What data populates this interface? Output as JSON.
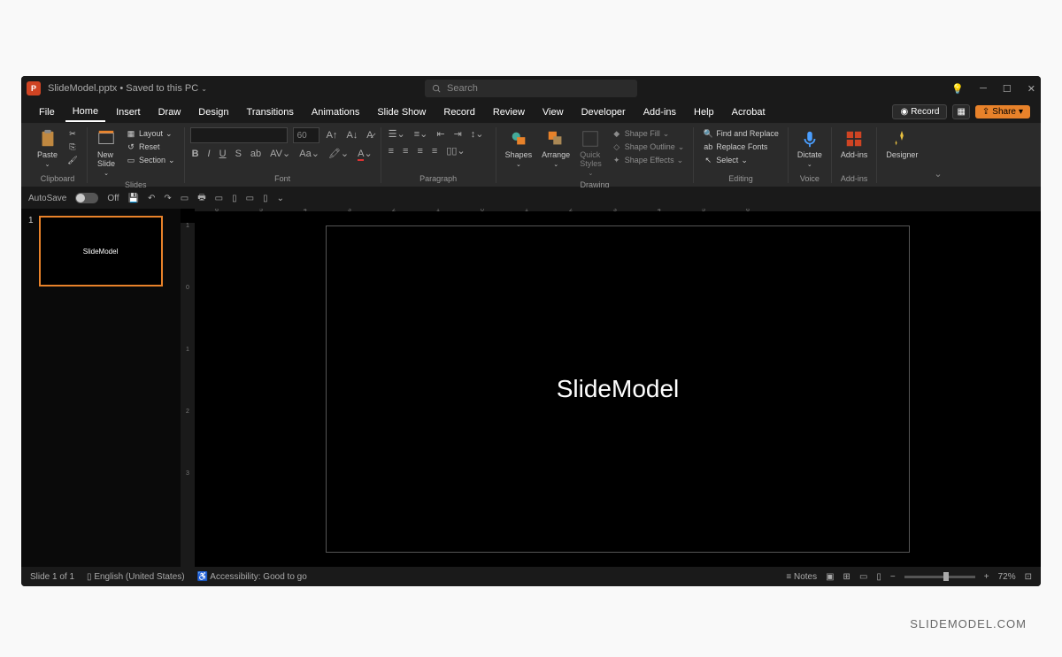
{
  "title": {
    "filename": "SlideModel.pptx",
    "saved": "Saved to this PC"
  },
  "search": {
    "placeholder": "Search"
  },
  "menus": [
    "File",
    "Home",
    "Insert",
    "Draw",
    "Design",
    "Transitions",
    "Animations",
    "Slide Show",
    "Record",
    "Review",
    "View",
    "Developer",
    "Add-ins",
    "Help",
    "Acrobat"
  ],
  "activeMenu": "Home",
  "topbuttons": {
    "record": "Record",
    "share": "Share"
  },
  "ribbon": {
    "clipboard": {
      "label": "Clipboard",
      "paste": "Paste"
    },
    "slides": {
      "label": "Slides",
      "newslide": "New\nSlide",
      "layout": "Layout",
      "reset": "Reset",
      "section": "Section"
    },
    "font": {
      "label": "Font",
      "size": "60"
    },
    "paragraph": {
      "label": "Paragraph"
    },
    "drawing": {
      "label": "Drawing",
      "shapes": "Shapes",
      "arrange": "Arrange",
      "quick": "Quick\nStyles",
      "fill": "Shape Fill",
      "outline": "Shape Outline",
      "effects": "Shape Effects"
    },
    "editing": {
      "label": "Editing",
      "find": "Find and Replace",
      "replace": "Replace Fonts",
      "select": "Select"
    },
    "voice": {
      "label": "Voice",
      "dictate": "Dictate"
    },
    "addins": {
      "label": "Add-ins",
      "addins": "Add-ins"
    },
    "designer": {
      "designer": "Designer"
    }
  },
  "qat": {
    "autosave": "AutoSave",
    "off": "Off"
  },
  "thumb": {
    "num": "1",
    "text": "SlideModel"
  },
  "slide": {
    "text": "SlideModel"
  },
  "status": {
    "slide": "Slide 1 of 1",
    "lang": "English (United States)",
    "access": "Accessibility: Good to go",
    "notes": "Notes",
    "zoom": "72%"
  },
  "rulerH": [
    "6",
    "5",
    "4",
    "3",
    "2",
    "1",
    "0",
    "1",
    "2",
    "3",
    "4",
    "5",
    "6"
  ],
  "rulerV": [
    "1",
    "0",
    "1",
    "2",
    "3"
  ],
  "watermark": "SLIDEMODEL.COM"
}
